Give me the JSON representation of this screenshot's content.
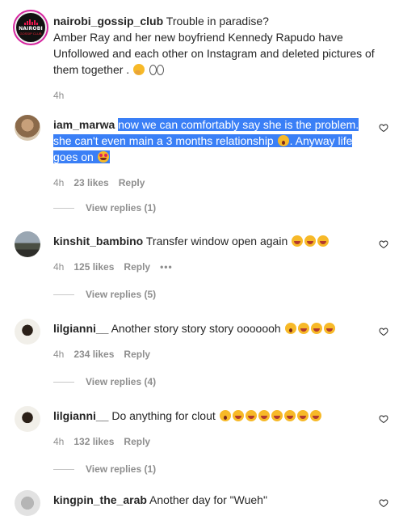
{
  "post": {
    "username": "nairobi_gossip_club",
    "avatar_text": "NAIROBI",
    "avatar_subtext": "GOSSIP CLUB",
    "caption_line1": "Trouble in paradise?",
    "caption_line2": "Amber Ray and her new boyfriend Kennedy Rapudo have Unfollowed and each other on Instagram and deleted pictures of them together .",
    "time": "4h"
  },
  "comments": [
    {
      "username": "iam_marwa",
      "text_a": "now we can comfortably say she is the problem. she can't even main a 3 months relationship",
      "text_b": ". Anyway life goes on",
      "time": "4h",
      "likes": "23 likes",
      "reply": "Reply",
      "view_replies": "View replies (1)"
    },
    {
      "username": "kinshit_bambino",
      "text": "Transfer window open again",
      "time": "4h",
      "likes": "125 likes",
      "reply": "Reply",
      "more": "•••",
      "view_replies": "View replies (5)"
    },
    {
      "username": "lilgianni__",
      "text": "Another story story story ooooooh",
      "time": "4h",
      "likes": "234 likes",
      "reply": "Reply",
      "view_replies": "View replies (4)"
    },
    {
      "username": "lilgianni__",
      "text": "Do anything for clout",
      "time": "4h",
      "likes": "132 likes",
      "reply": "Reply",
      "view_replies": "View replies (1)"
    },
    {
      "username": "kingpin_the_arab",
      "text": "Another day for \"Wueh\""
    }
  ],
  "colors": {
    "highlight": "#3a7ff6",
    "muted": "#8e8e8e",
    "text": "#262626"
  },
  "icons": [
    "heart-icon",
    "more-options-icon",
    "emoji-laugh-icon",
    "emoji-wow-icon",
    "emoji-think-icon",
    "emoji-eyes-icon",
    "emoji-heart-eyes-icon"
  ]
}
